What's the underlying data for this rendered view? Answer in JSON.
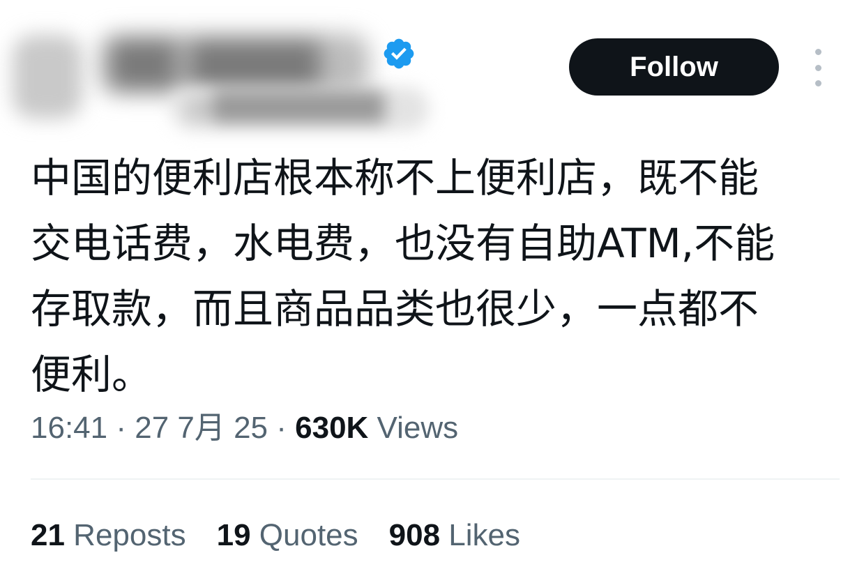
{
  "author": {
    "display_name": "██ ████",
    "handle": "@████████",
    "verified_icon": "verified-badge-icon",
    "verified_color": "#1d9bf0"
  },
  "follow_button": {
    "label": "Follow",
    "bg_color": "#0f1419",
    "text_color": "#ffffff"
  },
  "more_icon": "more-vertical-icon",
  "tweet": {
    "lines": [
      "中国的便利店根本称不上便利店，既不能",
      "交电话费，水电费，也没有自助ATM,不能",
      "存取款，而且商品品类也很少，一点都不",
      "便利。"
    ]
  },
  "meta": {
    "time": "16:41",
    "sep1": " · ",
    "date": "27 7月 25",
    "sep2": " · ",
    "views_count": "630K",
    "views_label": " Views"
  },
  "stats": {
    "reposts_count": "21",
    "reposts_label": " Reposts",
    "quotes_count": "19",
    "quotes_label": " Quotes",
    "likes_count": "908",
    "likes_label": " Likes"
  }
}
